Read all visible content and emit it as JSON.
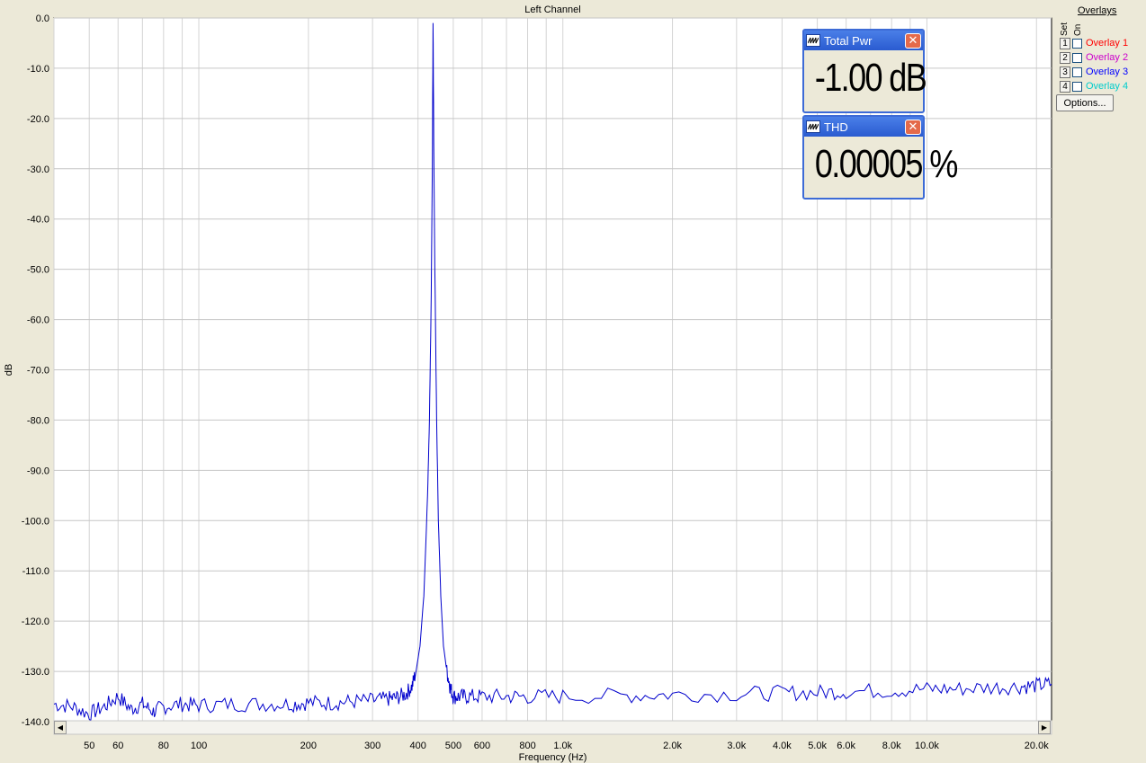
{
  "chart_data": {
    "type": "line",
    "title": "Left Channel",
    "xlabel": "Frequency (Hz)",
    "ylabel": "dB",
    "x_scale": "log",
    "xlim": [
      40,
      22000
    ],
    "ylim": [
      -140,
      0
    ],
    "grid": true,
    "x_ticks": [
      {
        "value": 50,
        "label": "50"
      },
      {
        "value": 60,
        "label": "60"
      },
      {
        "value": 80,
        "label": "80"
      },
      {
        "value": 100,
        "label": "100"
      },
      {
        "value": 200,
        "label": "200"
      },
      {
        "value": 300,
        "label": "300"
      },
      {
        "value": 400,
        "label": "400"
      },
      {
        "value": 500,
        "label": "500"
      },
      {
        "value": 600,
        "label": "600"
      },
      {
        "value": 800,
        "label": "800"
      },
      {
        "value": 1000,
        "label": "1.0k"
      },
      {
        "value": 2000,
        "label": "2.0k"
      },
      {
        "value": 3000,
        "label": "3.0k"
      },
      {
        "value": 4000,
        "label": "4.0k"
      },
      {
        "value": 5000,
        "label": "5.0k"
      },
      {
        "value": 6000,
        "label": "6.0k"
      },
      {
        "value": 8000,
        "label": "8.0k"
      },
      {
        "value": 10000,
        "label": "10.0k"
      },
      {
        "value": 20000,
        "label": "20.0k"
      }
    ],
    "y_ticks": [
      {
        "value": 0,
        "label": "0.0"
      },
      {
        "value": -10,
        "label": "-10.0"
      },
      {
        "value": -20,
        "label": "-20.0"
      },
      {
        "value": -30,
        "label": "-30.0"
      },
      {
        "value": -40,
        "label": "-40.0"
      },
      {
        "value": -50,
        "label": "-50.0"
      },
      {
        "value": -60,
        "label": "-60.0"
      },
      {
        "value": -70,
        "label": "-70.0"
      },
      {
        "value": -80,
        "label": "-80.0"
      },
      {
        "value": -90,
        "label": "-90.0"
      },
      {
        "value": -100,
        "label": "-100.0"
      },
      {
        "value": -110,
        "label": "-110.0"
      },
      {
        "value": -120,
        "label": "-120.0"
      },
      {
        "value": -130,
        "label": "-130.0"
      },
      {
        "value": -140,
        "label": "-140.0"
      }
    ],
    "series": [
      {
        "color": "#0000cc",
        "x": [
          40,
          45,
          50,
          55,
          60,
          65,
          70,
          75,
          80,
          90,
          100,
          120,
          150,
          180,
          200,
          230,
          260,
          300,
          330,
          350,
          370,
          385,
          395,
          405,
          415,
          425,
          430,
          435,
          438,
          440,
          442,
          445,
          450,
          455,
          462,
          470,
          480,
          490,
          500,
          520,
          550,
          600,
          700,
          800,
          1000,
          1500,
          2000,
          3000,
          4000,
          5000,
          6000,
          8000,
          10000,
          12000,
          15000,
          18000,
          20000,
          22000
        ],
        "y": [
          -136.5,
          -137,
          -138.5,
          -137,
          -135,
          -137.5,
          -136.5,
          -138,
          -137,
          -136.5,
          -136.8,
          -136.5,
          -136.5,
          -136.5,
          -136.2,
          -136.3,
          -136,
          -135.8,
          -135.5,
          -135.2,
          -134.5,
          -133,
          -130,
          -125,
          -115,
          -95,
          -80,
          -55,
          -30,
          -1,
          -25,
          -50,
          -80,
          -100,
          -115,
          -125,
          -130,
          -133,
          -135,
          -135,
          -135,
          -135,
          -135,
          -135,
          -135,
          -134.8,
          -134.6,
          -134.5,
          -134.3,
          -134.2,
          -134,
          -133.8,
          -133.5,
          -133.5,
          -133.2,
          -133,
          -132.8,
          -132.5
        ]
      }
    ]
  },
  "overlays": {
    "header": "Overlays",
    "set_label": "Set",
    "on_label": "On",
    "items": [
      {
        "set": "1",
        "label": "Overlay 1",
        "color": "#ff0000"
      },
      {
        "set": "2",
        "label": "Overlay 2",
        "color": "#cc00cc"
      },
      {
        "set": "3",
        "label": "Overlay 3",
        "color": "#0000ff"
      },
      {
        "set": "4",
        "label": "Overlay 4",
        "color": "#00cccc"
      }
    ],
    "options_label": "Options..."
  },
  "meters": [
    {
      "title": "Total Pwr",
      "value": "-1.00 dB"
    },
    {
      "title": "THD",
      "value": "0.00005 %"
    }
  ]
}
